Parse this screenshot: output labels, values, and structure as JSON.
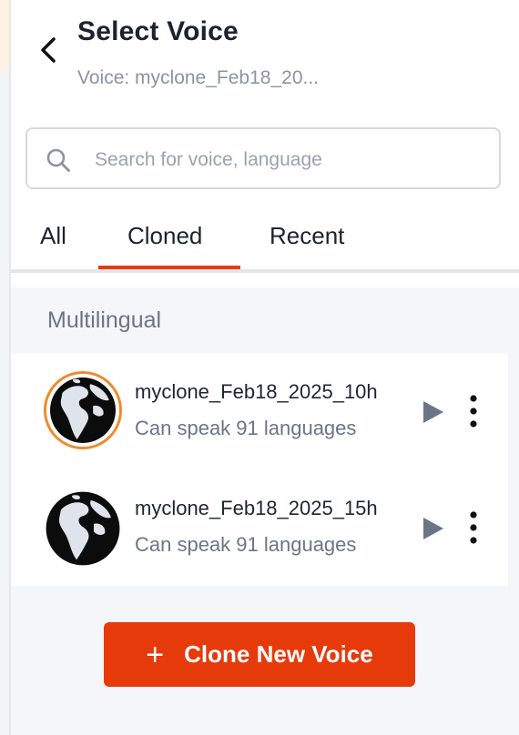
{
  "header": {
    "title": "Select Voice",
    "subtitle": "Voice: myclone_Feb18_20..."
  },
  "search": {
    "placeholder": "Search for voice, language",
    "value": ""
  },
  "tabs": [
    {
      "label": "All"
    },
    {
      "label": "Cloned",
      "active": true
    },
    {
      "label": "Recent"
    }
  ],
  "section": {
    "label": "Multilingual"
  },
  "voices": [
    {
      "name": "myclone_Feb18_2025_10h",
      "desc": "Can speak 91 languages",
      "selected": true
    },
    {
      "name": "myclone_Feb18_2025_15h",
      "desc": "Can speak 91 languages",
      "selected": false
    }
  ],
  "actions": {
    "clone_label": "Clone New Voice",
    "clone_icon": "plus-icon"
  },
  "colors": {
    "accent": "#e63a0b",
    "selected_ring": "#f08a2c",
    "play_icon": "#6b7588"
  }
}
